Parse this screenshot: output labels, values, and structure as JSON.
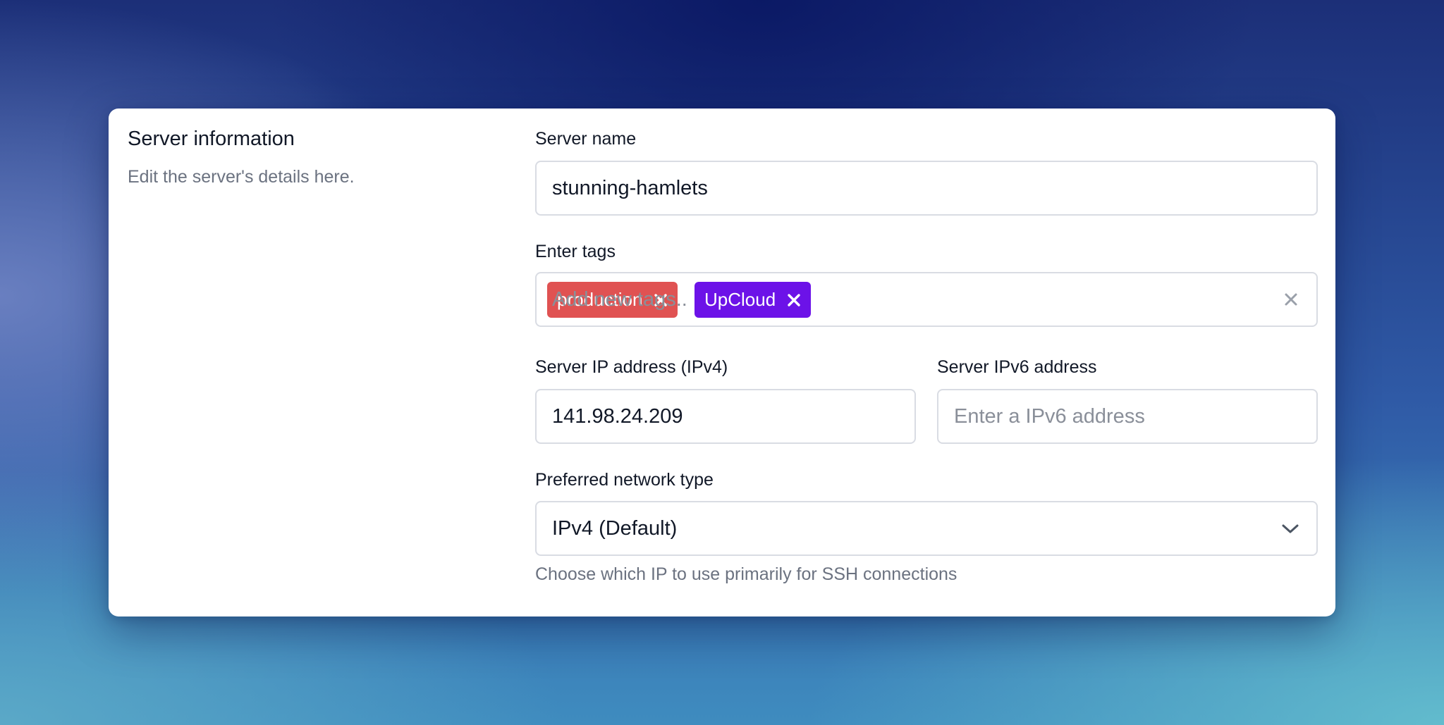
{
  "colors": {
    "tag_production": "#e05252",
    "tag_upcloud": "#6c12e8"
  },
  "section": {
    "title": "Server information",
    "description": "Edit the server's details here."
  },
  "server_name": {
    "label": "Server name",
    "value": "stunning-hamlets"
  },
  "tags": {
    "label": "Enter tags",
    "items": [
      {
        "label": "production",
        "color": "#e05252",
        "remove_icon": "close-icon"
      },
      {
        "label": "UpCloud",
        "color": "#6c12e8",
        "remove_icon": "close-icon"
      }
    ],
    "placeholder": "Add new tags..",
    "clear_icon": "close-icon"
  },
  "ipv4": {
    "label": "Server IP address (IPv4)",
    "value": "141.98.24.209"
  },
  "ipv6": {
    "label": "Server IPv6 address",
    "value": "",
    "placeholder": "Enter a IPv6 address"
  },
  "network_type": {
    "label": "Preferred network type",
    "selected": "IPv4 (Default)",
    "dropdown_icon": "chevron-down-icon",
    "helper": "Choose which IP to use primarily for SSH connections"
  }
}
